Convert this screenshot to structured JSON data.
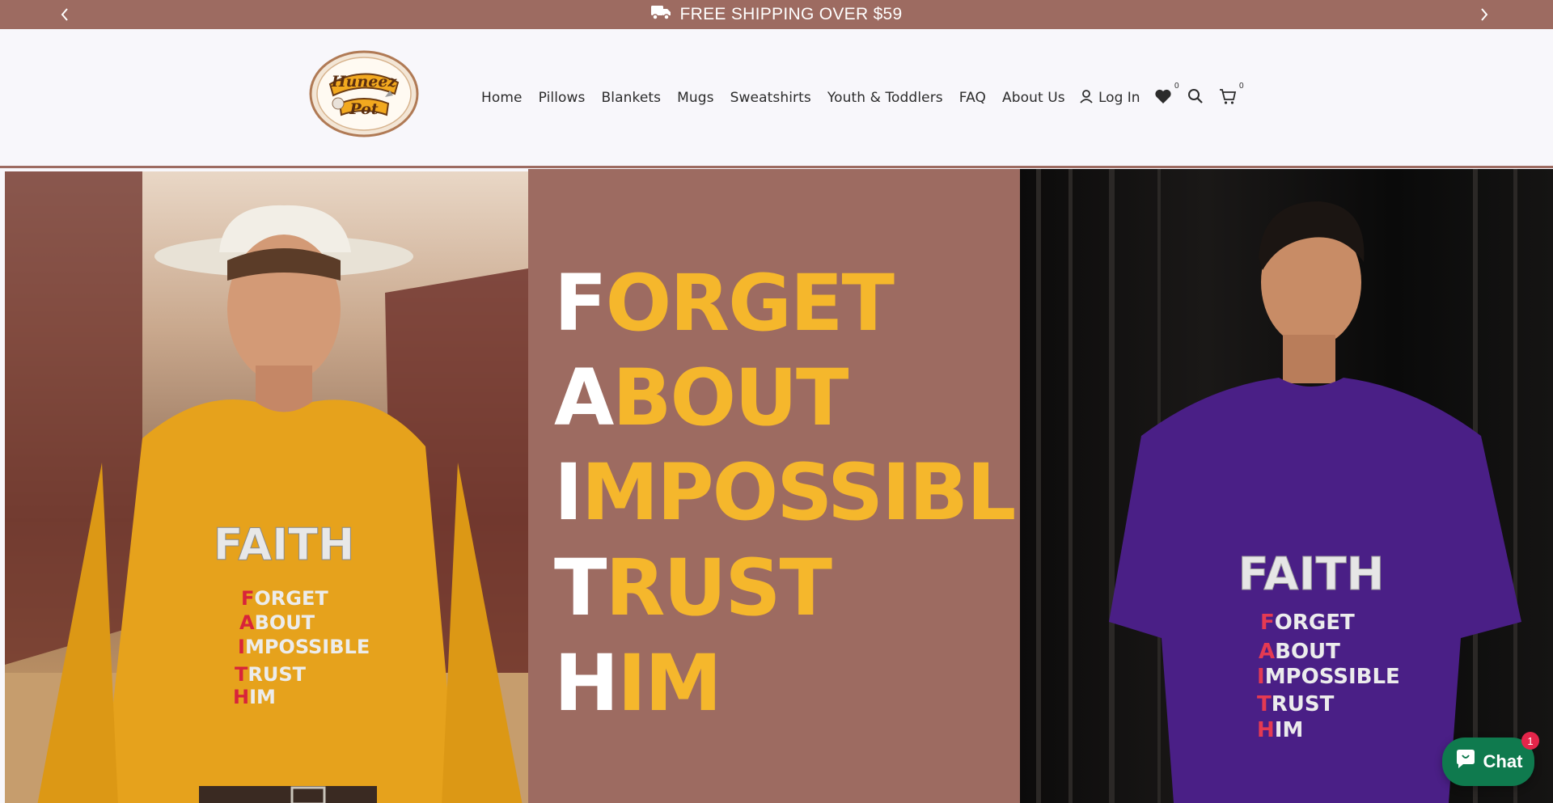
{
  "announcement": {
    "text": "FREE SHIPPING OVER $59",
    "icon": "truck-icon",
    "prev_icon": "chevron-left-icon",
    "next_icon": "chevron-right-icon"
  },
  "header": {
    "logo": {
      "line1": "Huneez",
      "line2": "Pot"
    },
    "nav": [
      "Home",
      "Pillows",
      "Blankets",
      "Mugs",
      "Sweatshirts",
      "Youth & Toddlers",
      "FAQ",
      "About Us"
    ],
    "login_label": "Log In",
    "wishlist_count": "0",
    "cart_count": "0"
  },
  "hero": {
    "lines": [
      {
        "first": "F",
        "rest": "ORGET"
      },
      {
        "first": "A",
        "rest": "BOUT"
      },
      {
        "first": "I",
        "rest": "MPOSSIBLE"
      },
      {
        "first": "T",
        "rest": "RUST"
      },
      {
        "first": "H",
        "rest": "IM"
      }
    ],
    "shirt_left": {
      "arc": "FAITH",
      "lines": [
        [
          "F",
          "ORGET"
        ],
        [
          "A",
          "BOUT"
        ],
        [
          "I",
          "MPOSSIBLE"
        ],
        [
          "T",
          "RUST"
        ],
        [
          "H",
          "IM"
        ]
      ]
    },
    "shirt_right": {
      "arc": "FAITH",
      "lines": [
        [
          "F",
          "ORGET"
        ],
        [
          "A",
          "BOUT"
        ],
        [
          "I",
          "MPOSSIBLE"
        ],
        [
          "T",
          "RUST"
        ],
        [
          "H",
          "IM"
        ]
      ]
    }
  },
  "chat": {
    "label": "Chat",
    "badge": "1"
  },
  "colors": {
    "brand": "#9d6b61",
    "accent": "#f5b72c",
    "chat": "#0f7a4e",
    "badge": "#e4254a",
    "shirt_left": "#e6a21c",
    "shirt_right": "#4a1f86"
  }
}
